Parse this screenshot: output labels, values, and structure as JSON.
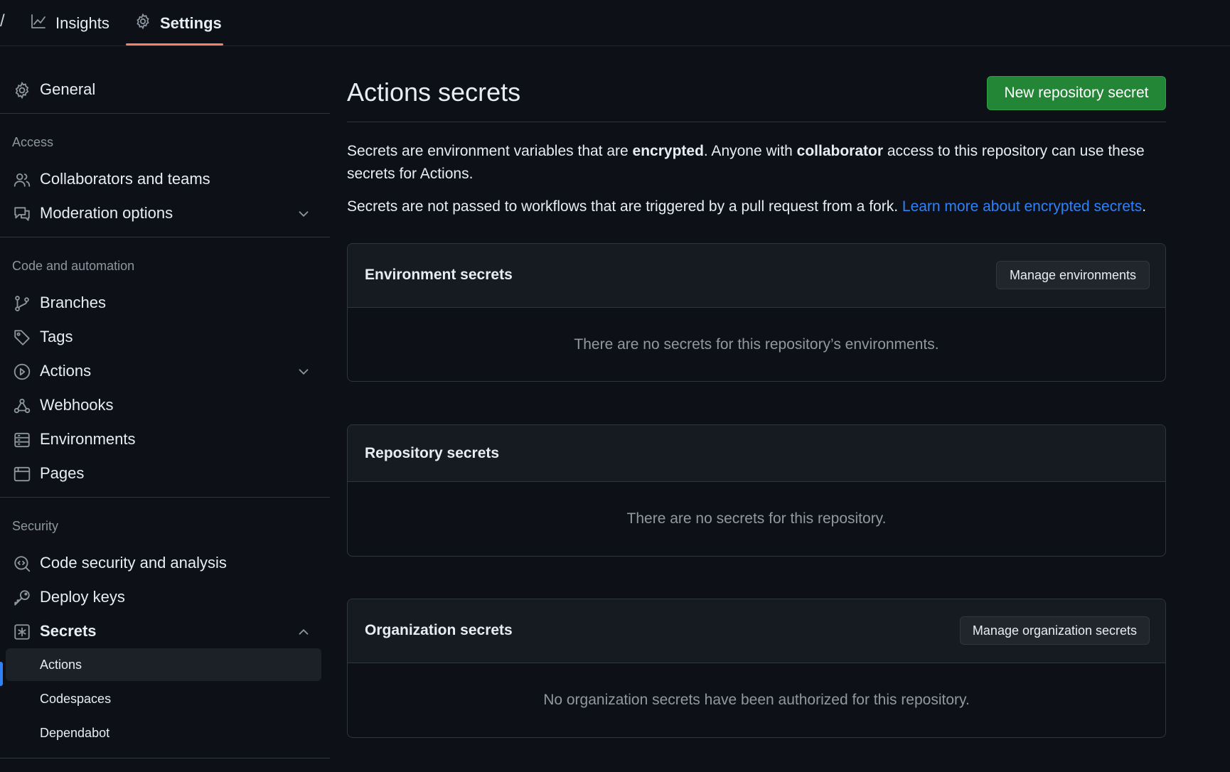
{
  "topnav": {
    "fragment": "/",
    "tabs": [
      {
        "label": "Insights"
      },
      {
        "label": "Settings"
      }
    ]
  },
  "sidebar": {
    "general": "General",
    "access_heading": "Access",
    "collaborators": "Collaborators and teams",
    "moderation": "Moderation options",
    "code_heading": "Code and automation",
    "branches": "Branches",
    "tags": "Tags",
    "actions": "Actions",
    "webhooks": "Webhooks",
    "environments": "Environments",
    "pages": "Pages",
    "security_heading": "Security",
    "code_security": "Code security and analysis",
    "deploy_keys": "Deploy keys",
    "secrets": "Secrets",
    "secrets_sub": [
      "Actions",
      "Codespaces",
      "Dependabot"
    ]
  },
  "main": {
    "title": "Actions secrets",
    "new_button": "New repository secret",
    "desc1_a": "Secrets are environment variables that are ",
    "desc1_b": "encrypted",
    "desc1_c": ". Anyone with ",
    "desc1_d": "collaborator",
    "desc1_e": " access to this repository can use these secrets for Actions.",
    "desc2_a": "Secrets are not passed to workflows that are triggered by a pull request from a fork. ",
    "desc2_link": "Learn more about encrypted secrets",
    "desc2_end": ".",
    "env_box": {
      "heading": "Environment secrets",
      "button": "Manage environments",
      "empty": "There are no secrets for this repository’s environments."
    },
    "repo_box": {
      "heading": "Repository secrets",
      "empty": "There are no secrets for this repository."
    },
    "org_box": {
      "heading": "Organization secrets",
      "button": "Manage organization secrets",
      "empty": "No organization secrets have been authorized for this repository."
    }
  },
  "colors": {
    "background": "#0d1117",
    "accent_tab": "#f78166",
    "primary_button": "#238636",
    "link": "#2f81f7"
  }
}
